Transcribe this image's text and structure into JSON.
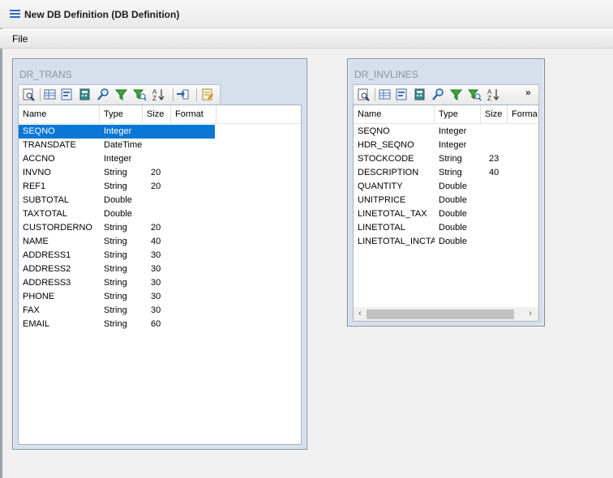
{
  "window": {
    "title": "New DB Definition (DB Definition)"
  },
  "menu": {
    "file": "File"
  },
  "icons": {
    "toolbar": [
      "preview-icon",
      "grid-icon",
      "form-icon",
      "calculator-icon",
      "search-icon",
      "filter-icon",
      "filter-search-icon",
      "sort-az-icon",
      "import-icon",
      "notes-icon"
    ],
    "overflow": "»",
    "scroll_left": "‹",
    "scroll_right": "›"
  },
  "tables": [
    {
      "name": "DR_TRANS",
      "columns": [
        "Name",
        "Type",
        "Size",
        "Format"
      ],
      "selected_row": 0,
      "rows": [
        {
          "name": "SEQNO",
          "type": "Integer",
          "size": ""
        },
        {
          "name": "TRANSDATE",
          "type": "DateTime",
          "size": ""
        },
        {
          "name": "ACCNO",
          "type": "Integer",
          "size": ""
        },
        {
          "name": "INVNO",
          "type": "String",
          "size": "20"
        },
        {
          "name": "REF1",
          "type": "String",
          "size": "20"
        },
        {
          "name": "SUBTOTAL",
          "type": "Double",
          "size": ""
        },
        {
          "name": "TAXTOTAL",
          "type": "Double",
          "size": ""
        },
        {
          "name": "CUSTORDERNO",
          "type": "String",
          "size": "20"
        },
        {
          "name": "NAME",
          "type": "String",
          "size": "40"
        },
        {
          "name": "ADDRESS1",
          "type": "String",
          "size": "30"
        },
        {
          "name": "ADDRESS2",
          "type": "String",
          "size": "30"
        },
        {
          "name": "ADDRESS3",
          "type": "String",
          "size": "30"
        },
        {
          "name": "PHONE",
          "type": "String",
          "size": "30"
        },
        {
          "name": "FAX",
          "type": "String",
          "size": "30"
        },
        {
          "name": "EMAIL",
          "type": "String",
          "size": "60"
        }
      ]
    },
    {
      "name": "DR_INVLINES",
      "columns": [
        "Name",
        "Type",
        "Size",
        "Forma"
      ],
      "rows": [
        {
          "name": "SEQNO",
          "type": "Integer",
          "size": ""
        },
        {
          "name": "HDR_SEQNO",
          "type": "Integer",
          "size": ""
        },
        {
          "name": "STOCKCODE",
          "type": "String",
          "size": "23"
        },
        {
          "name": "DESCRIPTION",
          "type": "String",
          "size": "40"
        },
        {
          "name": "QUANTITY",
          "type": "Double",
          "size": ""
        },
        {
          "name": "UNITPRICE",
          "type": "Double",
          "size": ""
        },
        {
          "name": "LINETOTAL_TAX",
          "type": "Double",
          "size": ""
        },
        {
          "name": "LINETOTAL",
          "type": "Double",
          "size": ""
        },
        {
          "name": "LINETOTAL_INCTAX",
          "type": "Double",
          "size": ""
        }
      ]
    }
  ]
}
